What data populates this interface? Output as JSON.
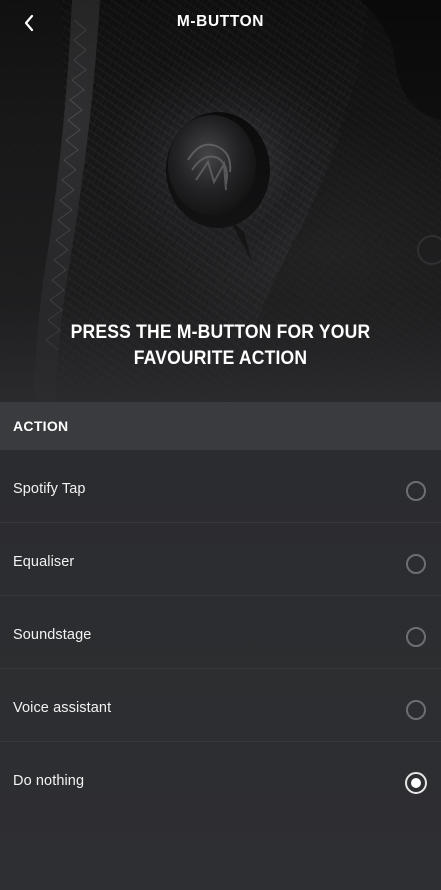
{
  "header": {
    "title": "M-BUTTON",
    "back_icon": "chevron-left-icon"
  },
  "hero": {
    "headline_line1": "PRESS THE M-BUTTON FOR YOUR",
    "headline_line2": "FAVOURITE ACTION"
  },
  "section": {
    "title": "ACTION"
  },
  "options": [
    {
      "label": "Spotify Tap",
      "selected": false
    },
    {
      "label": "Equaliser",
      "selected": false
    },
    {
      "label": "Soundstage",
      "selected": false
    },
    {
      "label": "Voice assistant",
      "selected": false
    },
    {
      "label": "Do nothing",
      "selected": true
    }
  ],
  "colors": {
    "background": "#2a2b2e",
    "section_header": "#3a3b3e",
    "radio_border": "#6d6e71",
    "text": "#ffffff"
  }
}
